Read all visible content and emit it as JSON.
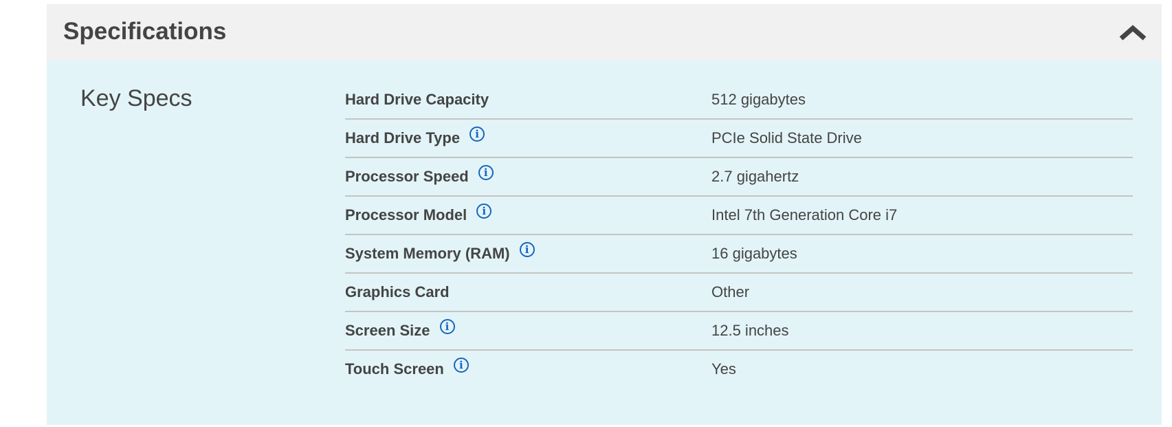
{
  "header": {
    "title": "Specifications",
    "toggle_icon": "chevron-up-icon"
  },
  "section": {
    "title": "Key Specs"
  },
  "colors": {
    "header_bg": "#f1f1f1",
    "body_bg": "#e3f4f8",
    "text": "#444444",
    "info_icon": "#1565c0"
  },
  "specs": [
    {
      "label": "Hard Drive Capacity",
      "value": "512 gigabytes",
      "info": false
    },
    {
      "label": "Hard Drive Type",
      "value": "PCIe Solid State Drive",
      "info": true
    },
    {
      "label": "Processor Speed",
      "value": "2.7 gigahertz",
      "info": true
    },
    {
      "label": "Processor Model",
      "value": "Intel 7th Generation Core i7",
      "info": true
    },
    {
      "label": "System Memory (RAM)",
      "value": "16 gigabytes",
      "info": true
    },
    {
      "label": "Graphics Card",
      "value": "Other",
      "info": false
    },
    {
      "label": "Screen Size",
      "value": "12.5 inches",
      "info": true
    },
    {
      "label": "Touch Screen",
      "value": "Yes",
      "info": true
    }
  ]
}
